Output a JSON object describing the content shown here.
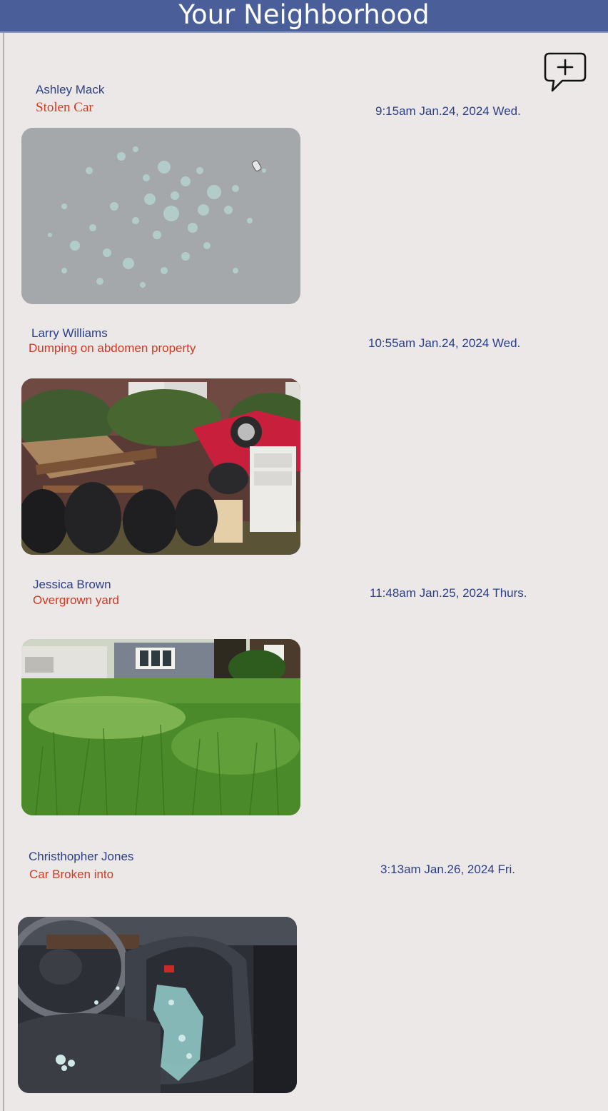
{
  "header": {
    "title": "Your Neighborhood"
  },
  "compose": {
    "icon": "new-message-icon"
  },
  "posts": [
    {
      "author": "Ashley Mack",
      "subject": "Stolen Car",
      "timestamp": "9:15am Jan.24, 2024 Wed.",
      "photo": "shattered-glass-on-pavement"
    },
    {
      "author": "Larry Williams",
      "subject": "Dumping on abdomen property",
      "timestamp": "10:55am Jan.24, 2024 Wed.",
      "photo": "dumped-trash-and-furniture"
    },
    {
      "author": "Jessica Brown",
      "subject": "Overgrown yard",
      "timestamp": "11:48am Jan.25, 2024 Thurs.",
      "photo": "overgrown-grass-yard"
    },
    {
      "author": "Christhopher Jones",
      "subject": "Car Broken into",
      "timestamp": "3:13am Jan.26, 2024 Fri.",
      "photo": "broken-glass-on-car-seat"
    }
  ],
  "colors": {
    "header_bg": "#4a5f99",
    "page_bg": "#ede8e8",
    "name_text": "#2a3f88",
    "subject_text": "#cf3a23"
  }
}
